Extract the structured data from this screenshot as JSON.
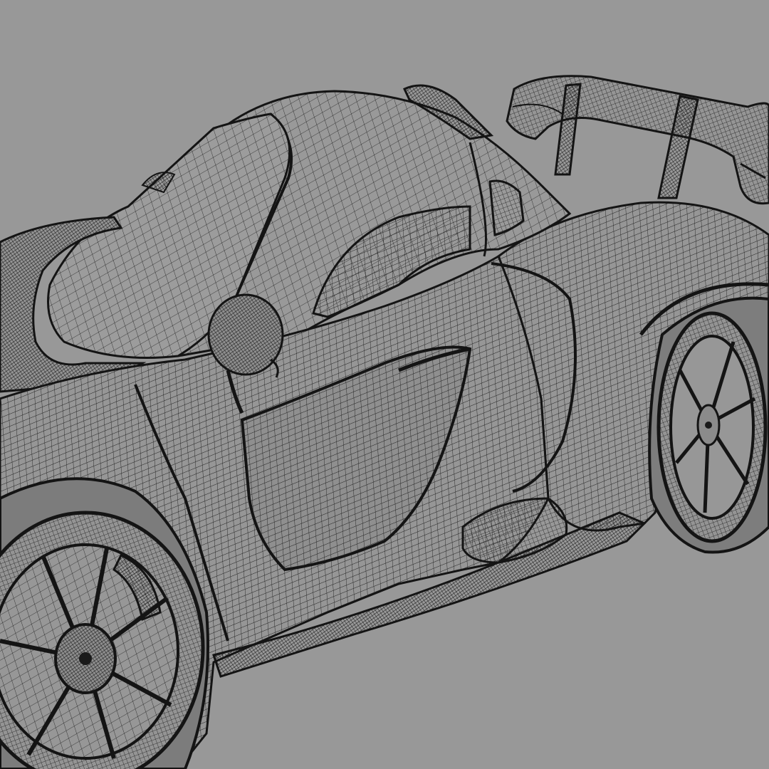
{
  "viewport": {
    "background_color": "#989898",
    "wire_color": "#1a1a1a",
    "description_icon": "wireframe-car-model"
  }
}
